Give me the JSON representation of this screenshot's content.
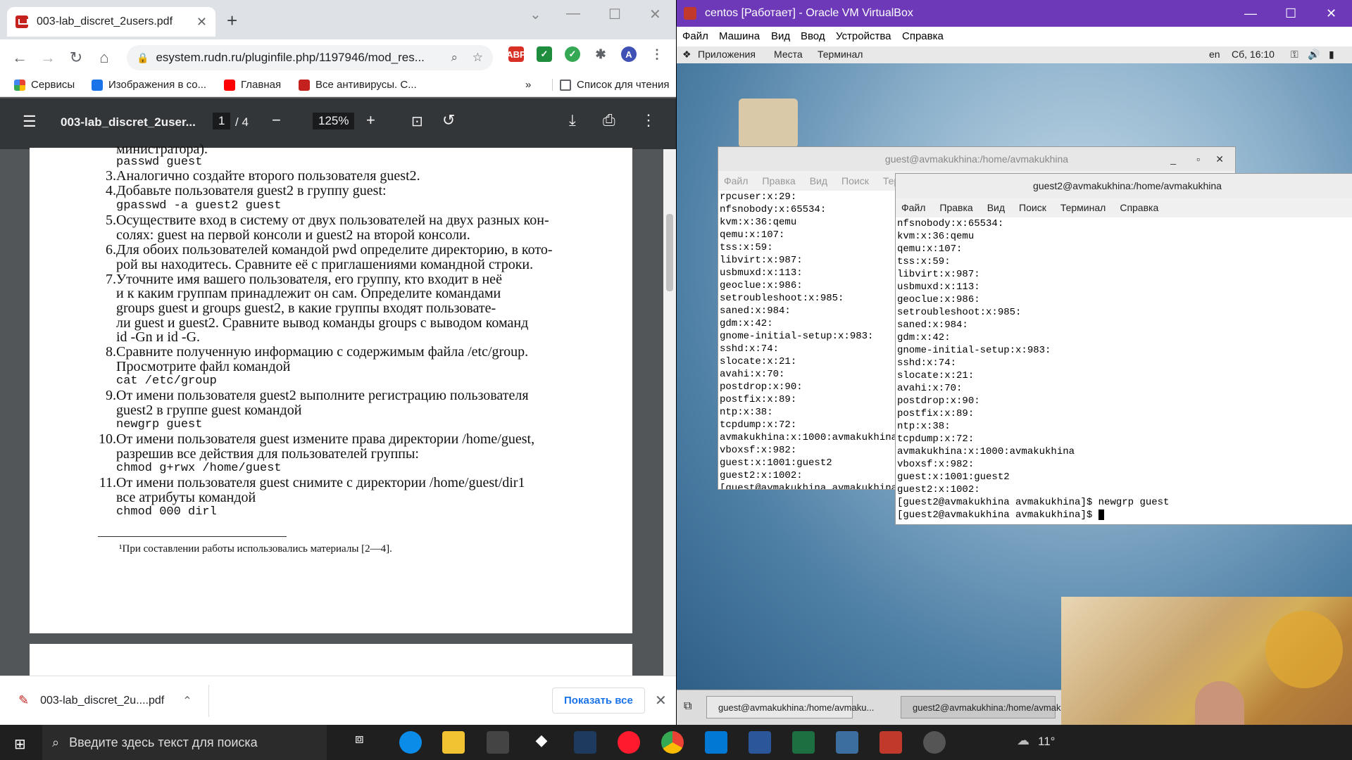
{
  "chrome": {
    "tab_title": "003-lab_discret_2users.pdf",
    "url": "esystem.rudn.ru/pluginfile.php/1197946/mod_res...",
    "profile_initial": "A",
    "bookmarks": [
      "Сервисы",
      "Изображения в со...",
      "Главная",
      "Все антивирусы. С...",
      "»",
      "Список для чтения"
    ],
    "pdf": {
      "title": "003-lab_discret_2user...",
      "page": "1",
      "total": "/ 4",
      "zoom": "125%"
    },
    "doc": {
      "top_frag": "министратора).",
      "l0": "passwd guest",
      "n3": "3.",
      "t3": "Аналогично создайте второго пользователя guest2.",
      "n4": "4.",
      "t4": "Добавьте пользователя guest2 в группу guest:",
      "c4": "gpasswd -a guest2 guest",
      "n5": "5.",
      "t5a": "Осуществите вход в систему от двух пользователей на двух разных кон-",
      "t5b": "солях: guest на первой консоли и guest2 на второй консоли.",
      "n6": "6.",
      "t6a": "Для обоих пользователей командой pwd определите директорию, в кото-",
      "t6b": "рой вы находитесь. Сравните её с приглашениями командной строки.",
      "n7": "7.",
      "t7a": "Уточните имя вашего пользователя, его группу, кто входит в неё",
      "t7b": "и к каким группам принадлежит он сам. Определите командами",
      "t7c": "groups guest и groups guest2, в какие группы входят пользовате-",
      "t7d": "ли guest и guest2. Сравните вывод команды groups с выводом команд",
      "t7e": "id -Gn и id -G.",
      "n8": "8.",
      "t8a": "Сравните полученную информацию с содержимым файла /etc/group.",
      "t8b": "Просмотрите файл командой",
      "c8": "cat /etc/group",
      "n9": "9.",
      "t9a": "От имени пользователя guest2 выполните регистрацию пользователя",
      "t9b": "guest2 в группе guest командой",
      "c9": "newgrp guest",
      "n10": "10.",
      "t10a": "От имени пользователя guest измените права директории /home/guest,",
      "t10b": "разрешив все действия для пользователей группы:",
      "c10": "chmod g+rwx /home/guest",
      "n11": "11.",
      "t11a": "От имени пользователя guest снимите с директории /home/guest/dir1",
      "t11b": "все атрибуты командой",
      "c11": "chmod 000 dirl",
      "footnote": "¹При составлении работы использовались материалы [2—4]."
    },
    "download": {
      "file": "003-lab_discret_2u....pdf",
      "show_all": "Показать все"
    }
  },
  "vbox": {
    "title": "centos [Работает] - Oracle VM VirtualBox",
    "menu": [
      "Файл",
      "Машина",
      "Вид",
      "Ввод",
      "Устройства",
      "Справка"
    ],
    "gnome": {
      "apps": "Приложения",
      "places": "Места",
      "terminal": "Терминал",
      "lang": "en",
      "clock": "Сб, 16:10"
    },
    "term1": {
      "title": "guest@avmakukhina:/home/avmakukhina",
      "menu": [
        "Файл",
        "Правка",
        "Вид",
        "Поиск",
        "Терм"
      ],
      "lines": [
        "rpcuser:x:29:",
        "nfsnobody:x:65534:",
        "kvm:x:36:qemu",
        "qemu:x:107:",
        "tss:x:59:",
        "libvirt:x:987:",
        "usbmuxd:x:113:",
        "geoclue:x:986:",
        "setroubleshoot:x:985:",
        "saned:x:984:",
        "gdm:x:42:",
        "gnome-initial-setup:x:983:",
        "sshd:x:74:",
        "slocate:x:21:",
        "avahi:x:70:",
        "postdrop:x:90:",
        "postfix:x:89:",
        "ntp:x:38:",
        "tcpdump:x:72:",
        "avmakukhina:x:1000:avmakukhina",
        "vboxsf:x:982:",
        "guest:x:1001:guest2",
        "guest2:x:1002:",
        "[guest@avmakukhina avmakukhina"
      ]
    },
    "term2": {
      "title": "guest2@avmakukhina:/home/avmakukhina",
      "menu": [
        "Файл",
        "Правка",
        "Вид",
        "Поиск",
        "Терминал",
        "Справка"
      ],
      "lines": [
        "nfsnobody:x:65534:",
        "kvm:x:36:qemu",
        "qemu:x:107:",
        "tss:x:59:",
        "libvirt:x:987:",
        "usbmuxd:x:113:",
        "geoclue:x:986:",
        "setroubleshoot:x:985:",
        "saned:x:984:",
        "gdm:x:42:",
        "gnome-initial-setup:x:983:",
        "sshd:x:74:",
        "slocate:x:21:",
        "avahi:x:70:",
        "postdrop:x:90:",
        "postfix:x:89:",
        "ntp:x:38:",
        "tcpdump:x:72:",
        "avmakukhina:x:1000:avmakukhina",
        "vboxsf:x:982:",
        "guest:x:1001:guest2",
        "guest2:x:1002:",
        "[guest2@avmakukhina avmakukhina]$ newgrp guest",
        "[guest2@avmakukhina avmakukhina]$ "
      ]
    },
    "task1": "guest@avmakukhina:/home/avmaku...",
    "task2": "guest2@avmakukhina:/home/avmak"
  },
  "taskbar": {
    "search": "Введите здесь текст для поиска",
    "temp": "11°"
  }
}
